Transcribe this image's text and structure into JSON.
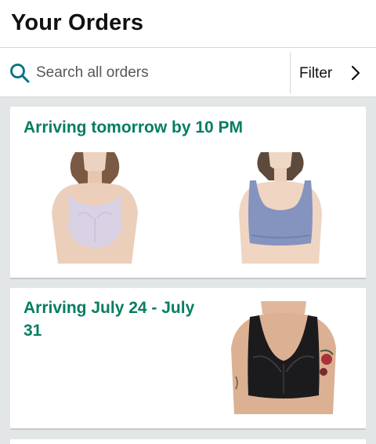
{
  "header": {
    "title": "Your Orders"
  },
  "search": {
    "placeholder": "Search all orders",
    "icon": "search-icon",
    "icon_color": "#007185"
  },
  "filter": {
    "label": "Filter",
    "icon": "chevron-right-icon"
  },
  "orders": [
    {
      "status": "Arriving tomorrow by 10 PM",
      "status_color": "#067d62",
      "items": [
        {
          "product": "lilac scoop-neck bra",
          "color": "#d9d1e4"
        },
        {
          "product": "blue scoop-neck bra",
          "color": "#8593bf"
        }
      ]
    },
    {
      "status": "Arriving July 24 - July 31",
      "status_color": "#067d62",
      "items": [
        {
          "product": "black lace bra",
          "color": "#1b1b1d"
        }
      ]
    }
  ]
}
